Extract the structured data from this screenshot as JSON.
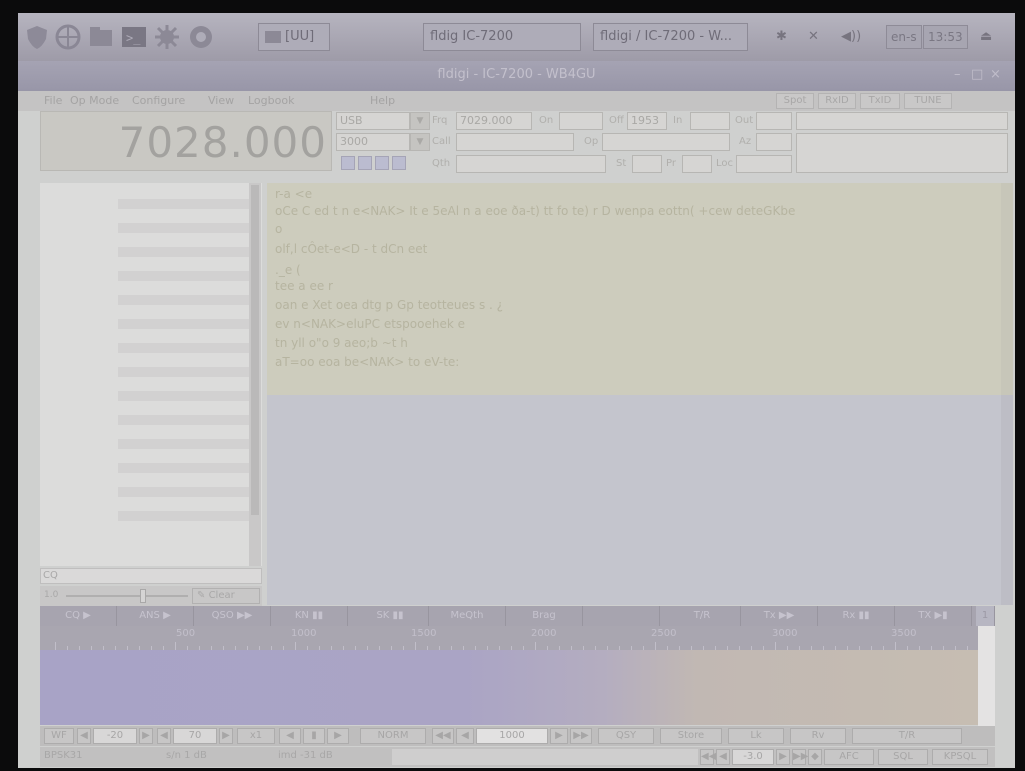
{
  "taskbar": {
    "folder_label": "[UU]",
    "window1_label": "fldig IC-7200",
    "window2_label": "fldigi / IC-7200 - W...",
    "keyboard_label": "en-s",
    "clock": "13:53"
  },
  "titlebar": {
    "title": "fldigi - IC-7200 - WB4GU"
  },
  "menu": {
    "file": "File",
    "op_mode": "Op Mode",
    "configure": "Configure",
    "view": "View",
    "logbook": "Logbook",
    "help": "Help",
    "spot": "Spot",
    "rxid": "RxID",
    "txid": "TxID",
    "tune": "TUNE"
  },
  "rig": {
    "frequency": "7028.000",
    "mode": "USB",
    "bandwidth": "3000",
    "freq_label": "Frq",
    "freq_value": "7029.000",
    "on_label": "On",
    "off_label": "Off",
    "off_value": "1953",
    "in_label": "In",
    "out_label": "Out",
    "call_label": "Call",
    "op_label": "Op",
    "az_label": "Az",
    "qth_label": "Qth",
    "st_label": "St",
    "pr_label": "Pr",
    "loc_label": "Loc"
  },
  "rx_text": [
    "r-a <e",
    "oCe C  ed t n e<NAK> It e  5eAl n  a eoe   ða-t) tt  fo te) r D wenpa eottn(  +cew deteGKbe",
    "o",
    " olf,l cÔet-e<D - t dCn eet",
    "._e (",
    "tee a ee r",
    "oan e   Xet  oea dtg p Gp teotteues  s  .  ¿",
    "ev n<NAK>eluPC  etspooehek e",
    "tn   yll o\"o  9 aeo;b ~t     h",
    " aT=oo  eoa be<NAK> to eV-te:"
  ],
  "cq_input": "CQ",
  "slider_value": "1.0",
  "clear_label": "Clear",
  "macros": [
    "CQ",
    "ANS",
    "QSO",
    "KN",
    "SK",
    "MeQth",
    "Brag",
    "",
    "T/R",
    "Tx",
    "Rx",
    "TX"
  ],
  "macro_index": "1",
  "scale_ticks": [
    "500",
    "1000",
    "1500",
    "2000",
    "2500",
    "3000",
    "3500"
  ],
  "controls": {
    "wf_label": "WF",
    "wf_low": "-20",
    "wf_high": "70",
    "x1_label": "x1",
    "norm_label": "NORM",
    "carrier": "1000",
    "qsy_label": "QSY",
    "store_label": "Store",
    "lk_label": "Lk",
    "rv_label": "Rv",
    "tr_label": "T/R"
  },
  "status": {
    "mode": "BPSK31",
    "sn": "s/n  1 dB",
    "imd": "imd -31 dB",
    "squelch_value": "-3.0",
    "afc_label": "AFC",
    "sql_label": "SQL",
    "kpsql_label": "KPSQL"
  },
  "colors": {
    "taskbar": "#a8a6b3",
    "rx_pane": "#cdccbd",
    "tx_pane": "#c4c5cd",
    "waterfall_blue": "#a8a3c6",
    "frequency_text": "#a3a29f"
  }
}
